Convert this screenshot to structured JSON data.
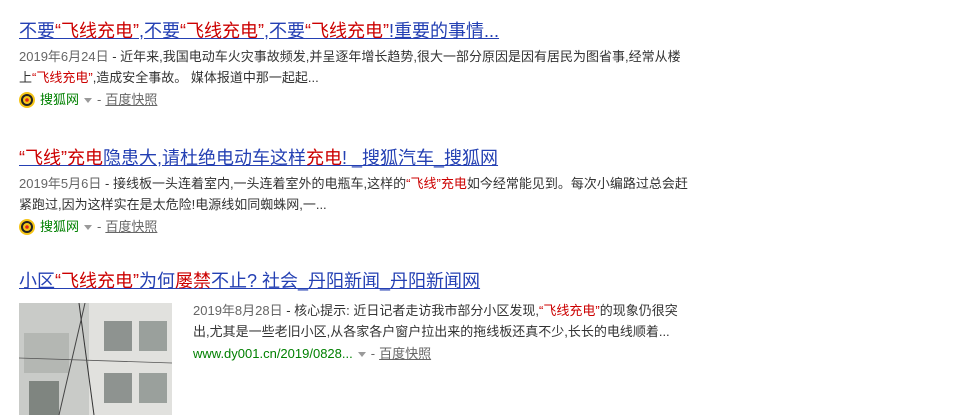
{
  "results": [
    {
      "title_parts": [
        "不要",
        "“飞线充电”",
        ",不要",
        "“飞线充电”",
        ",不要",
        "“飞线充电”",
        "!重要的事情..."
      ],
      "date": "2019年6月24日",
      "abstract_parts": [
        " - 近年来,我国电动车火灾事故频发,并呈逐年增长趋势,很大一部分原因是因有居民为图省事,经常从楼上",
        "“飞线充电”",
        ",造成安全事故。 媒体报道中那一起起..."
      ],
      "source": "搜狐网",
      "separator": "-",
      "cache": "百度快照"
    },
    {
      "title_parts": [
        "“飞线”",
        "充电",
        "隐患大,请杜绝电动车这样",
        "充电",
        "! _搜狐汽车_搜狐网"
      ],
      "date": "2019年5月6日",
      "abstract_parts": [
        " - 接线板一头连着室内,一头连着室外的电瓶车,这样的",
        "“飞线”充电",
        "如今经常能见到。每次小编路过总会赶紧跑过,因为这样实在是太危险!电源线如同蜘蛛网,一..."
      ],
      "source": "搜狐网",
      "separator": "-",
      "cache": "百度快照"
    },
    {
      "title_parts": [
        "小区",
        "“飞线充电”",
        "为何",
        "屡禁",
        "不止? 社会_丹阳新闻_丹阳新闻网"
      ],
      "date": "2019年8月28日",
      "abstract_parts": [
        " - 核心提示: 近日记者走访我市部分小区发现,",
        "“飞线充电”",
        "的现象仍很突出,尤其是一些老旧小区,从各家各户窗户拉出来的拖线板还真不少,长长的电线顺着..."
      ],
      "url": "www.dy001.cn/2019/0828...",
      "separator": "-",
      "cache": "百度快照"
    }
  ],
  "colors": {
    "title_link": "#2440b3",
    "highlight": "#cc0000",
    "url_green": "#008000",
    "text": "#333333",
    "muted": "#666666"
  },
  "icons": {
    "source_logo": "sohu-logo-icon",
    "dropdown": "caret-down-icon"
  }
}
